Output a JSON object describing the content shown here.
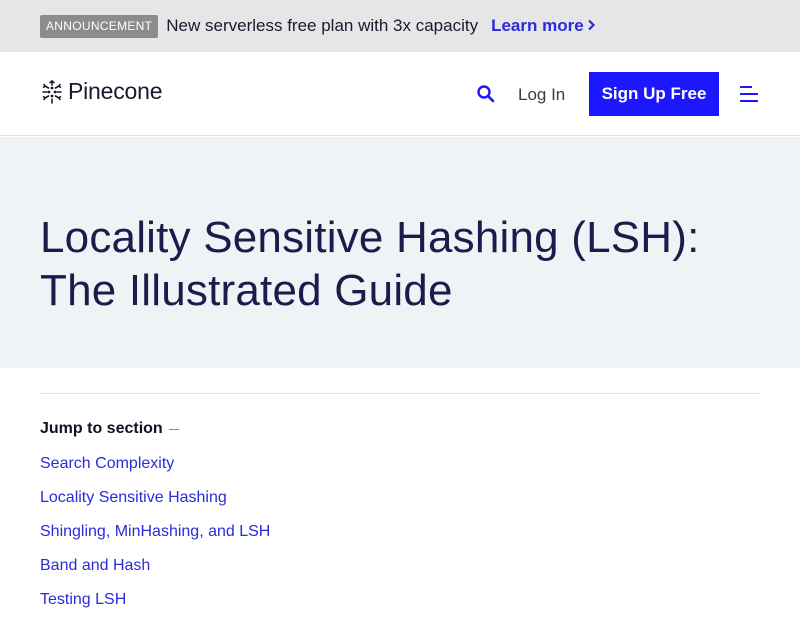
{
  "announcement": {
    "badge": "ANNOUNCEMENT",
    "text": "New serverless free plan with 3x capacity",
    "link_label": "Learn more",
    "link_icon": "chevron-right-icon"
  },
  "header": {
    "logo_text": "Pinecone",
    "logo_icon": "pinecone-logo-icon",
    "search_icon": "search-icon",
    "login_label": "Log In",
    "signup_label": "Sign Up Free",
    "menu_icon": "hamburger-menu-icon"
  },
  "hero": {
    "title_line1": "Locality Sensitive Hashing (LSH):",
    "title_line2": "The Illustrated Guide"
  },
  "toc": {
    "heading": "Jump to section",
    "items": [
      {
        "label": "Search Complexity"
      },
      {
        "label": "Locality Sensitive Hashing"
      },
      {
        "label": "Shingling, MinHashing, and LSH"
      },
      {
        "label": "Band and Hash"
      },
      {
        "label": "Testing LSH"
      }
    ]
  },
  "colors": {
    "accent": "#1c17ff",
    "link": "#2b2bdc",
    "announcement_bg": "#e6e6e6",
    "hero_bg": "#f0f3f6",
    "title": "#1d1b4b"
  }
}
